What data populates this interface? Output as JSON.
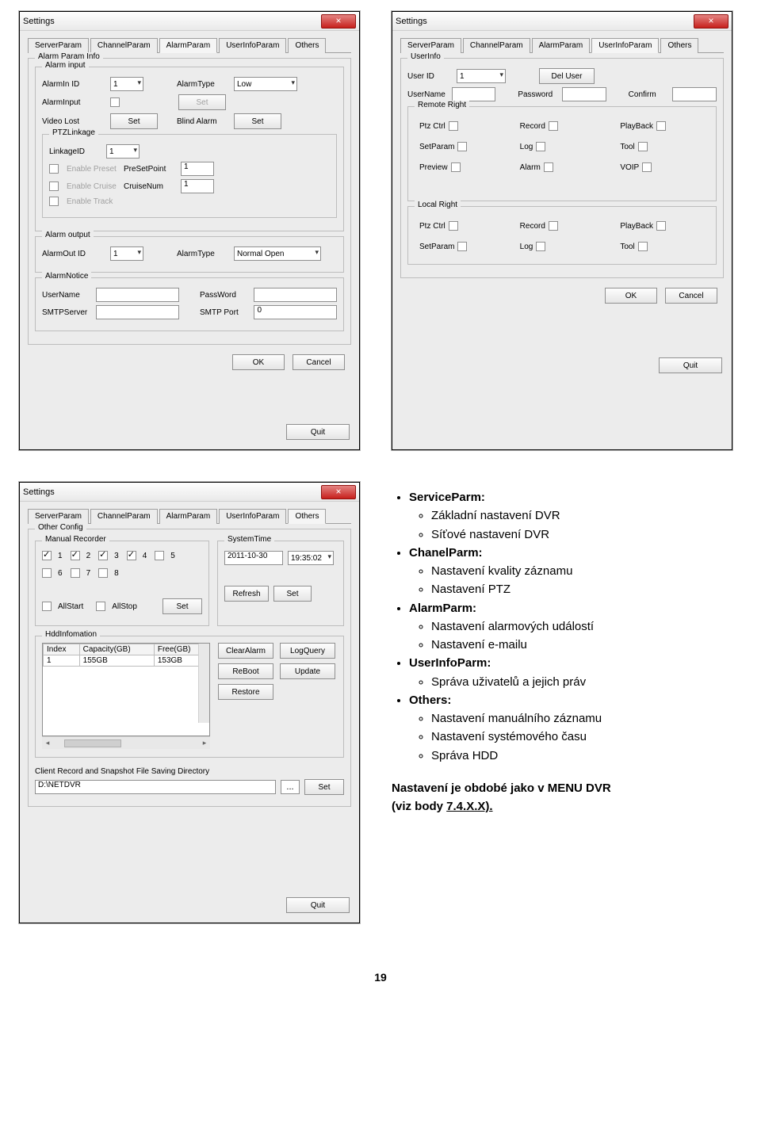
{
  "tabs": {
    "server": "ServerParam",
    "channel": "ChannelParam",
    "alarm": "AlarmParam",
    "user": "UserInfoParam",
    "others": "Others"
  },
  "common": {
    "settings_title": "Settings",
    "close_x": "×",
    "ok": "OK",
    "cancel": "Cancel",
    "quit": "Quit",
    "set": "Set"
  },
  "win1": {
    "g_paraminfo": "Alarm Param Info",
    "g_input": "Alarm input",
    "alarmin_id": "AlarmIn ID",
    "alarmin_id_val": "1",
    "alarmtype": "AlarmType",
    "alarmtype_val": "Low",
    "alarminput": "AlarmInput",
    "videolost": "Video Lost",
    "blindalarm": "Blind Alarm",
    "g_ptz": "PTZLinkage",
    "linkageid": "LinkageID",
    "linkageid_val": "1",
    "enable_preset": "Enable Preset",
    "presetpoint": "PreSetPoint",
    "presetpoint_val": "1",
    "enable_cruise": "Enable Cruise",
    "cruisenum": "CruiseNum",
    "cruisenum_val": "1",
    "enable_track": "Enable Track",
    "g_output": "Alarm output",
    "alarmout_id": "AlarmOut ID",
    "alarmout_id_val": "1",
    "alarmtype2_val": "Normal Open",
    "g_notice": "AlarmNotice",
    "username": "UserName",
    "password": "PassWord",
    "smtpserver": "SMTPServer",
    "smtpport": "SMTP Port",
    "smtpport_val": "0"
  },
  "win2": {
    "g_user": "UserInfo",
    "userid": "User ID",
    "userid_val": "1",
    "deluser": "Del User",
    "username": "UserName",
    "password": "Password",
    "confirm": "Confirm",
    "remote": "Remote Right",
    "local": "Local Right",
    "ptz": "Ptz Ctrl",
    "record": "Record",
    "playback": "PlayBack",
    "setparam": "SetParam",
    "log": "Log",
    "tool": "Tool",
    "preview": "Preview",
    "alarm": "Alarm",
    "voip": "VOIP"
  },
  "win3": {
    "g_other": "Other Config",
    "g_manual": "Manual Recorder",
    "systime": "SystemTime",
    "date": "2011-10-30",
    "time": "19:35:02",
    "allstart": "AllStart",
    "allstop": "AllStop",
    "refresh": "Refresh",
    "g_hdd": "HddInfomation",
    "tbl": {
      "index": "Index",
      "capacity": "Capacity(GB)",
      "free": "Free(GB)",
      "r_index": "1",
      "r_cap": "155GB",
      "r_free": "153GB"
    },
    "clearalarm": "ClearAlarm",
    "logquery": "LogQuery",
    "reboot": "ReBoot",
    "update": "Update",
    "restore": "Restore",
    "clientdir": "Client Record and Snapshot File Saving Directory",
    "dir": "D:\\NETDVR",
    "dots": "..."
  },
  "text": {
    "sp_title": "ServiceParm:",
    "sp_1": "Základní nastavení DVR",
    "sp_2": "Síťové nastavení DVR",
    "cp_title": "ChanelParm:",
    "cp_1": "Nastavení kvality záznamu",
    "cp_2": "Nastavení PTZ",
    "ap_title": "AlarmParm:",
    "ap_1": "Nastavení alarmových událostí",
    "ap_2": "Nastavení e-mailu",
    "up_title": "UserInfoParm:",
    "up_1": "Správa uživatelů a jejich práv",
    "ot_title": "Others:",
    "ot_1": "Nastavení manuálního záznamu",
    "ot_2": "Nastavení systémového času",
    "ot_3": "Správa HDD",
    "footer1": "Nastavení je obdobé jako v MENU DVR",
    "footer2": "(viz body ",
    "footer2u": "7.4.X.X).",
    "pagenum": "19"
  }
}
